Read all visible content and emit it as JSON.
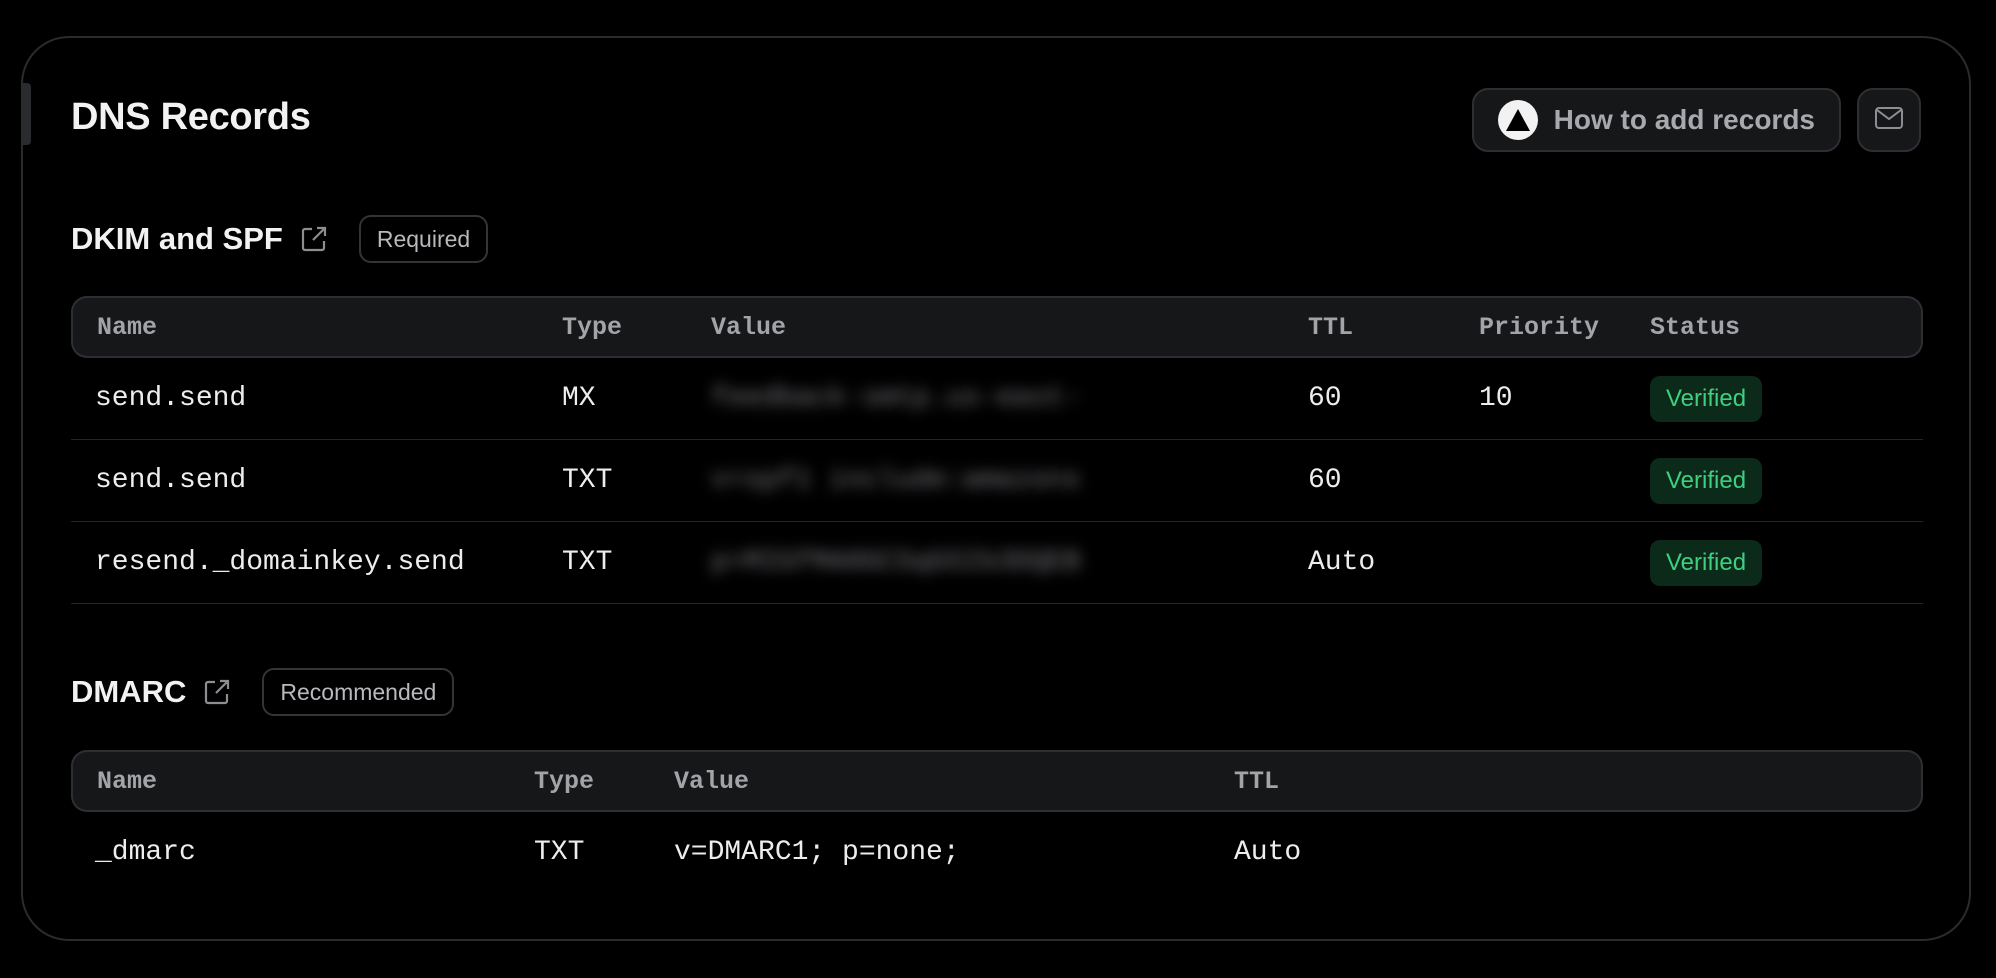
{
  "page": {
    "title": "DNS Records",
    "how_to_label": "How to add records"
  },
  "sections": {
    "dkim": {
      "title": "DKIM and SPF",
      "badge": "Required",
      "columns": [
        "Name",
        "Type",
        "Value",
        "TTL",
        "Priority",
        "Status"
      ],
      "rows": [
        {
          "name": "send.send",
          "type": "MX",
          "value": "feedback-smtp.us-east-",
          "ttl": "60",
          "priority": "10",
          "status": "Verified"
        },
        {
          "name": "send.send",
          "type": "TXT",
          "value": "v=spf1 include:amazons",
          "ttl": "60",
          "priority": "",
          "status": "Verified"
        },
        {
          "name": "resend._domainkey.send",
          "type": "TXT",
          "value": "p=MIGfMA0GCSqGSIb3DQEB",
          "ttl": "Auto",
          "priority": "",
          "status": "Verified"
        }
      ]
    },
    "dmarc": {
      "title": "DMARC",
      "badge": "Recommended",
      "columns": [
        "Name",
        "Type",
        "Value",
        "TTL"
      ],
      "rows": [
        {
          "name": "_dmarc",
          "type": "TXT",
          "value": "v=DMARC1; p=none;",
          "ttl": "Auto"
        }
      ]
    }
  },
  "icons": {
    "logo": "triangle-logo-icon",
    "mail": "mail-icon",
    "external": "external-link-icon"
  },
  "colors": {
    "background": "#000000",
    "surface": "#161719",
    "border": "#2e2f33",
    "verified_text": "#3fcf7f",
    "verified_bg": "#0b2a1a"
  }
}
